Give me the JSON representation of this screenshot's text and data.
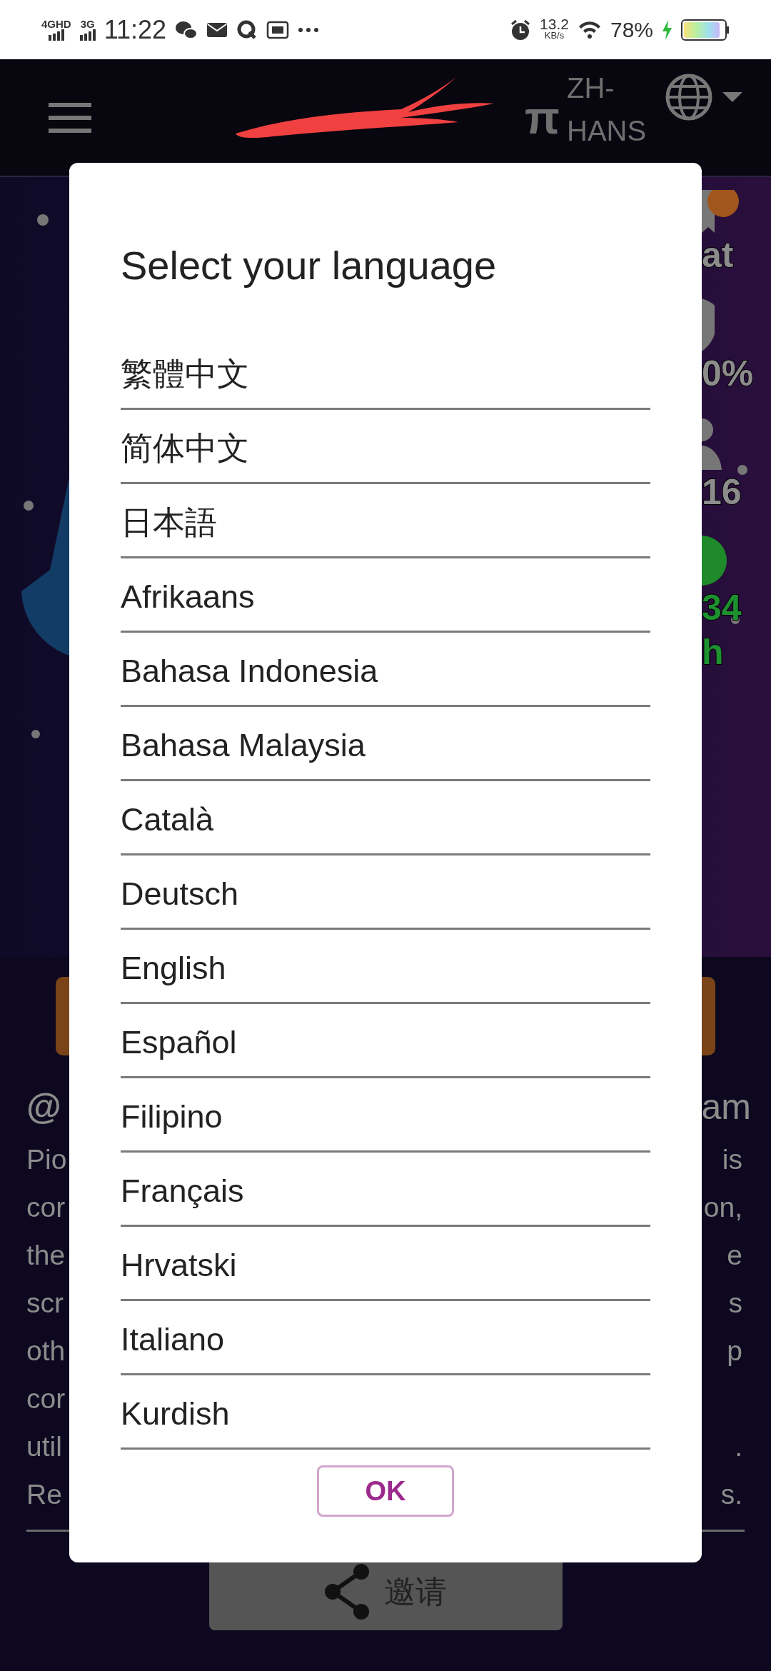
{
  "status_bar": {
    "network_1": "4GHD",
    "network_2": "3G",
    "time": "11:22",
    "speed": "13.2",
    "speed_unit": "KB/s",
    "battery": "78%",
    "charging": true
  },
  "header": {
    "currency": "π",
    "language_code": "ZH-HANS"
  },
  "stats": [
    {
      "kind": "badge",
      "text": "at"
    },
    {
      "kind": "shield",
      "text": "0%"
    },
    {
      "kind": "person",
      "text": "16"
    },
    {
      "kind": "rate",
      "text": "34",
      "sub": "h"
    }
  ],
  "profile": {
    "handle_start": "@",
    "handle_end": "am"
  },
  "paragraph_lines": [
    {
      "left": "Pio",
      "right": "is"
    },
    {
      "left": "cor",
      "right": "on,"
    },
    {
      "left": "the",
      "right": "e"
    },
    {
      "left": "scr",
      "right": "s"
    },
    {
      "left": "oth",
      "right": "p"
    },
    {
      "left": "cor"
    },
    {
      "left": "util",
      "right": "."
    },
    {
      "left": "Re",
      "right": "s."
    }
  ],
  "invite_button": {
    "label": "邀请"
  },
  "dialog": {
    "title": "Select your language",
    "languages": [
      "繁體中文",
      "简体中文",
      "日本語",
      "Afrikaans",
      "Bahasa Indonesia",
      "Bahasa Malaysia",
      "Català",
      "Deutsch",
      "English",
      "Español",
      "Filipino",
      "Français",
      "Hrvatski",
      "Italiano",
      "Kurdish"
    ],
    "ok": "OK"
  }
}
